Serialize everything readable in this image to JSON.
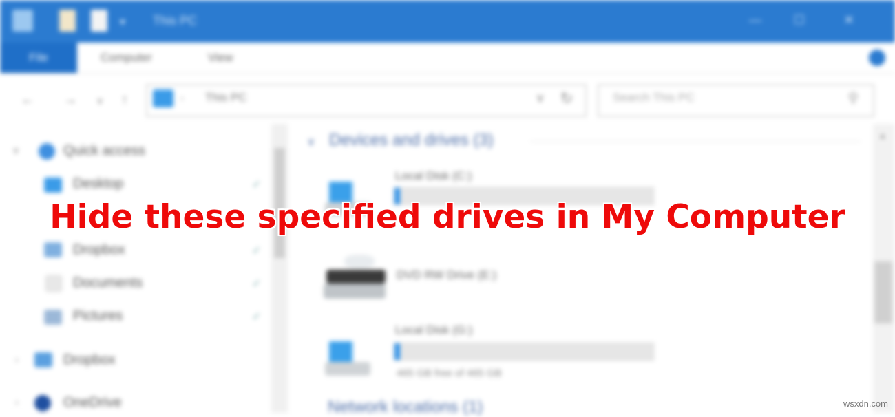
{
  "window": {
    "title": "This PC",
    "controls": [
      "—",
      "☐",
      "✕"
    ]
  },
  "ribbon": {
    "file_label": "File",
    "tabs": [
      "Computer",
      "View"
    ]
  },
  "address": {
    "path": "This PC",
    "search_placeholder": "Search This PC"
  },
  "sidebar": {
    "items": [
      {
        "label": "Quick access",
        "icon": "star-icon"
      },
      {
        "label": "Desktop",
        "icon": "desktop-icon"
      },
      {
        "label": "Downloads",
        "icon": "download-icon"
      },
      {
        "label": "Dropbox",
        "icon": "dropbox-icon"
      },
      {
        "label": "Documents",
        "icon": "document-icon"
      },
      {
        "label": "Pictures",
        "icon": "picture-icon"
      },
      {
        "label": "Dropbox",
        "icon": "dropbox-icon"
      },
      {
        "label": "OneDrive",
        "icon": "onedrive-icon"
      }
    ]
  },
  "content": {
    "section_title": "Devices and drives (3)",
    "next_section_title": "Network locations (1)",
    "drives": [
      {
        "name": "Local Disk (C:)",
        "used_fraction": 0.02,
        "free": ""
      },
      {
        "name": "DVD RW Drive (E:)",
        "used_fraction": null,
        "free": ""
      },
      {
        "name": "Local Disk (G:)",
        "used_fraction": 0.02,
        "free": "465 GB free of 465 GB"
      }
    ]
  },
  "overlay": {
    "headline": "Hide these specified drives in My Computer"
  },
  "watermark": "wsxdn.com",
  "colors": {
    "titlebar": "#2b7bd0",
    "headline": "#ee0a0a",
    "section": "#4d6ea8"
  }
}
